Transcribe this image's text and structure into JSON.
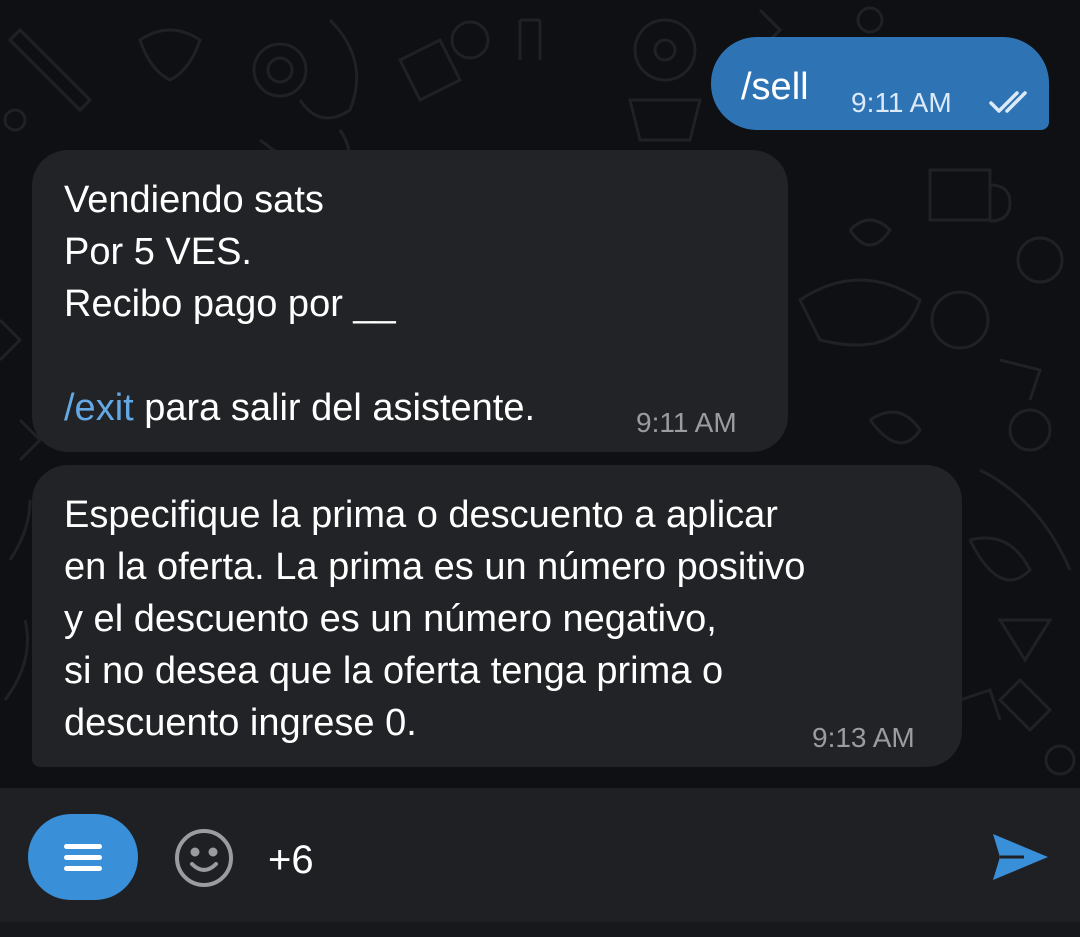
{
  "messages": [
    {
      "direction": "outgoing",
      "text": "/sell",
      "time": "9:11 AM",
      "status": "double-check-icon"
    },
    {
      "direction": "incoming",
      "lines": [
        "Vendiendo sats",
        "Por 5 VES.",
        "Recibo pago por __",
        ""
      ],
      "command": "/exit",
      "command_suffix": " para salir del asistente.",
      "time": "9:11 AM"
    },
    {
      "direction": "incoming",
      "lines": [
        "Especifique la prima o descuento a aplicar",
        "en la oferta. La prima es un número positivo",
        "y el descuento es un número negativo,",
        "si no desea que la oferta tenga prima o",
        "descuento ingrese 0."
      ],
      "time": "9:13 AM"
    }
  ],
  "composer": {
    "menu_icon": "menu-icon",
    "emoji_icon": "smiley-icon",
    "input_value": "+6",
    "send_icon": "send-icon"
  },
  "colors": {
    "background": "#0e1013",
    "outgoing_bubble": "#2e74b5",
    "incoming_bubble": "#222326",
    "link": "#64a9e6",
    "accent": "#3a8fd9"
  }
}
